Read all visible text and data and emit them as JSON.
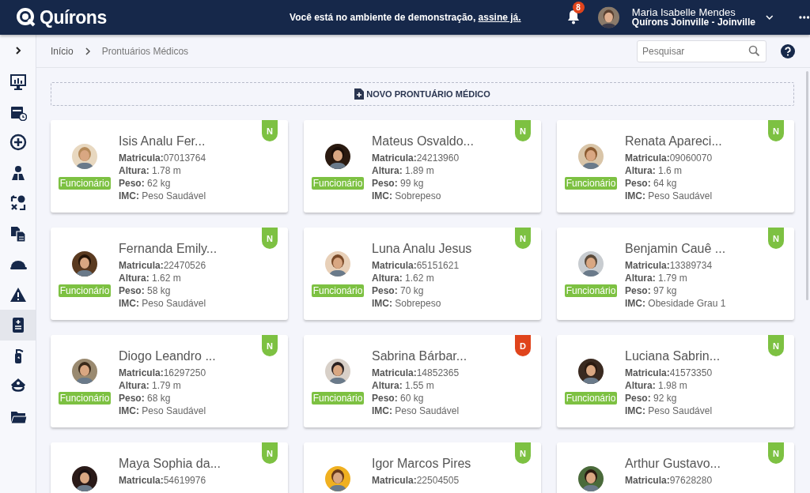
{
  "header": {
    "logo": "Quírons",
    "banner": "Você está no ambiente de demonstração, ",
    "banner_link": "assine já.",
    "notifications": "8",
    "user_name": "Maria Isabelle Mendes",
    "user_org": "Quírons Joinville - Joinville"
  },
  "sidebar": {
    "items": [
      {
        "kind": "monitor",
        "selected": false
      },
      {
        "kind": "calendar",
        "selected": false
      },
      {
        "kind": "plus",
        "selected": false
      },
      {
        "kind": "people",
        "selected": false
      },
      {
        "kind": "swap",
        "selected": false
      },
      {
        "kind": "documents",
        "selected": false
      },
      {
        "kind": "helmet",
        "selected": false
      },
      {
        "kind": "warning",
        "selected": false
      },
      {
        "kind": "clipboard",
        "selected": true
      },
      {
        "kind": "extinguisher",
        "selected": false
      },
      {
        "kind": "cap",
        "selected": false
      },
      {
        "kind": "folder",
        "selected": false
      }
    ]
  },
  "breadcrumb": [
    "Início",
    "Prontuários Médicos"
  ],
  "search": {
    "placeholder": "Pesquisar"
  },
  "new_button": "NOVO PRONTUÁRIO MÉDICO",
  "cards": [
    {
      "name": "Isis Analu Fer...",
      "details": [
        {
          "kind": "id",
          "label": "Matricula:",
          "value": "07013764"
        },
        {
          "kind": "height",
          "label": "Altura:",
          "value": "1.78 m"
        },
        {
          "kind": "weight",
          "label": "Peso:",
          "value": "62 kg"
        },
        {
          "kind": "bmi",
          "label": "IMC:",
          "value": "Peso Saudável"
        }
      ],
      "role": "Funcionário",
      "status": "N",
      "color": "#7dc142"
    },
    {
      "name": "Mateus Osvaldo...",
      "details": [
        {
          "kind": "id",
          "label": "Matricula:",
          "value": "24213960"
        },
        {
          "kind": "height",
          "label": "Altura:",
          "value": "1.89 m"
        },
        {
          "kind": "weight",
          "label": "Peso:",
          "value": "99 kg"
        },
        {
          "kind": "bmi",
          "label": "IMC:",
          "value": "Sobrepeso"
        }
      ],
      "role": "Funcionário",
      "status": "N",
      "color": "#7dc142"
    },
    {
      "name": "Renata Apareci...",
      "details": [
        {
          "kind": "id",
          "label": "Matricula:",
          "value": "09060070"
        },
        {
          "kind": "height",
          "label": "Altura:",
          "value": "1.6 m"
        },
        {
          "kind": "weight",
          "label": "Peso:",
          "value": "64 kg"
        },
        {
          "kind": "bmi",
          "label": "IMC:",
          "value": "Peso Saudável"
        }
      ],
      "role": "Funcionário",
      "status": "N",
      "color": "#7dc142"
    },
    {
      "name": "Fernanda Emily...",
      "details": [
        {
          "kind": "id",
          "label": "Matricula:",
          "value": "22470526"
        },
        {
          "kind": "height",
          "label": "Altura:",
          "value": "1.62 m"
        },
        {
          "kind": "weight",
          "label": "Peso:",
          "value": "58 kg"
        },
        {
          "kind": "bmi",
          "label": "IMC:",
          "value": "Peso Saudável"
        }
      ],
      "role": "Funcionário",
      "status": "N",
      "color": "#7dc142"
    },
    {
      "name": "Luna Analu Jesus",
      "details": [
        {
          "kind": "id",
          "label": "Matricula:",
          "value": "65151621"
        },
        {
          "kind": "height",
          "label": "Altura:",
          "value": "1.62 m"
        },
        {
          "kind": "weight",
          "label": "Peso:",
          "value": "70 kg"
        },
        {
          "kind": "bmi",
          "label": "IMC:",
          "value": "Sobrepeso"
        }
      ],
      "role": "Funcionário",
      "status": "N",
      "color": "#7dc142"
    },
    {
      "name": "Benjamin Cauê ...",
      "details": [
        {
          "kind": "id",
          "label": "Matricula:",
          "value": "13389734"
        },
        {
          "kind": "height",
          "label": "Altura:",
          "value": "1.79 m"
        },
        {
          "kind": "weight",
          "label": "Peso:",
          "value": "97 kg"
        },
        {
          "kind": "bmi",
          "label": "IMC:",
          "value": "Obesidade Grau 1"
        }
      ],
      "role": "Funcionário",
      "status": "N",
      "color": "#7dc142"
    },
    {
      "name": "Diogo Leandro ...",
      "details": [
        {
          "kind": "id",
          "label": "Matricula:",
          "value": "16297250"
        },
        {
          "kind": "height",
          "label": "Altura:",
          "value": "1.79 m"
        },
        {
          "kind": "weight",
          "label": "Peso:",
          "value": "68 kg"
        },
        {
          "kind": "bmi",
          "label": "IMC:",
          "value": "Peso Saudável"
        }
      ],
      "role": "Funcionário",
      "status": "N",
      "color": "#7dc142"
    },
    {
      "name": "Sabrina Bárbar...",
      "details": [
        {
          "kind": "id",
          "label": "Matricula:",
          "value": "14852365"
        },
        {
          "kind": "height",
          "label": "Altura:",
          "value": "1.55 m"
        },
        {
          "kind": "weight",
          "label": "Peso:",
          "value": "60 kg"
        },
        {
          "kind": "bmi",
          "label": "IMC:",
          "value": "Peso Saudável"
        }
      ],
      "role": "Funcionário",
      "status": "D",
      "color": "#e0441c"
    },
    {
      "name": "Luciana Sabrin...",
      "details": [
        {
          "kind": "id",
          "label": "Matricula:",
          "value": "41573350"
        },
        {
          "kind": "height",
          "label": "Altura:",
          "value": "1.98 m"
        },
        {
          "kind": "weight",
          "label": "Peso:",
          "value": "92 kg"
        },
        {
          "kind": "bmi",
          "label": "IMC:",
          "value": "Peso Saudável"
        }
      ],
      "role": "Funcionário",
      "status": "N",
      "color": "#7dc142"
    },
    {
      "name": "Maya Sophia da...",
      "details": [
        {
          "kind": "id",
          "label": "Matricula:",
          "value": "54619976"
        }
      ],
      "status": "N",
      "color": "#7dc142"
    },
    {
      "name": "Igor Marcos Pires",
      "details": [
        {
          "kind": "id",
          "label": "Matricula:",
          "value": "22504505"
        }
      ],
      "status": "N",
      "color": "#7dc142"
    },
    {
      "name": "Arthur Gustavo...",
      "details": [
        {
          "kind": "id",
          "label": "Matricula:",
          "value": "97628280"
        }
      ],
      "status": "N",
      "color": "#7dc142"
    }
  ]
}
